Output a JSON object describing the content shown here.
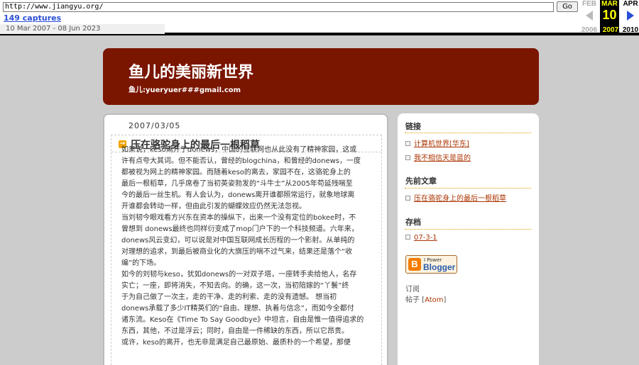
{
  "wayback": {
    "url": "http://www.jiangyu.org/",
    "go_label": "Go",
    "captures": "149 captures",
    "date_range": "10 Mar 2007 - 08 Jun 2023",
    "prev_month": "FEB",
    "prev_year": "2006",
    "cur_month": "MAR",
    "cur_day": "10",
    "cur_year": "2007",
    "next_month": "APR",
    "next_year": "2010"
  },
  "header": {
    "title": "鱼儿的美丽新世界",
    "description": "鱼儿:yueryuer###gmail.com"
  },
  "post": {
    "date": "2007/03/05",
    "title": "压在骆驼身上的最后一根稻草",
    "body": "如果说，keso离开了donews，中国的互联网也从此没有了精神家园，这或\n许有点夸大其词。但不能否认，曾经的blogchina，和曾经的donews，一度\n都被视为网上的精神家园。而随着keso的离去，家园不在，这骆驼身上的\n最后一根稻草，几乎席卷了当初英姿勃发的“斗牛士”从2005年苟延残喘至\n今的最后一丝生机。有人会认为，donews离开谁都照常运行，就象地球离\n开谁都会转动一样，但由此引发的蝴蝶效应仍然无法忽视。\n当刘韧今眼戏看方兴东在资本的操纵下，出来一个没有定位的bokee时，不\n曾想到 donews最终也同样衍变成了mop门户下的一个科技频道。六年来，\ndonews风云变幻，可以说是对中国互联网成长历程的一个影射。从单纯的\n对理想的追求，到最后被商业化的大旗压的喘不过气来，结果还是落个“收\n编”的下场。\n如今的刘韧与keso，犹如donews的一对双子塔，一座转手卖给他人，名存\n实亡；一座，即将消失，不知去向。的确，这一次，当初陪嫁的“丫鬟”终\n于为自己做了一次主，走的干净、走的利索、走的没有遗憾。 想当初\ndonews承载了多少IT精英们的“自由、理想、执着与信念”，而如今全都付\n诸东流。Keso在《Time To Say Goodbye》中坦言，自由是惟一值得追求的\n东西，其他，不过是浮云；同时，自由是一件稀缺的东西，所以它昂贵。\n或许，keso的离开，也无非是满足自己最原始、最质朴的一个希望，那便"
  },
  "sidebar": {
    "links_heading": "链接",
    "links": [
      "计算机世界[华东]",
      "我不相信天是蓝的"
    ],
    "prev_heading": "先前文章",
    "prev_posts": [
      "压在骆驼身上的最后一根稻草"
    ],
    "archive_heading": "存档",
    "archives": [
      "07-3-1"
    ],
    "blogger_small": "I Power",
    "blogger_big": "Blogger",
    "subscribe_label": "订阅",
    "subscribe_prefix": "帖子 [",
    "subscribe_link": "Atom",
    "subscribe_suffix": "]"
  },
  "colors": {
    "header_bg": "#7a1500",
    "link": "#aa3300",
    "page_bg": "#cccccc"
  }
}
